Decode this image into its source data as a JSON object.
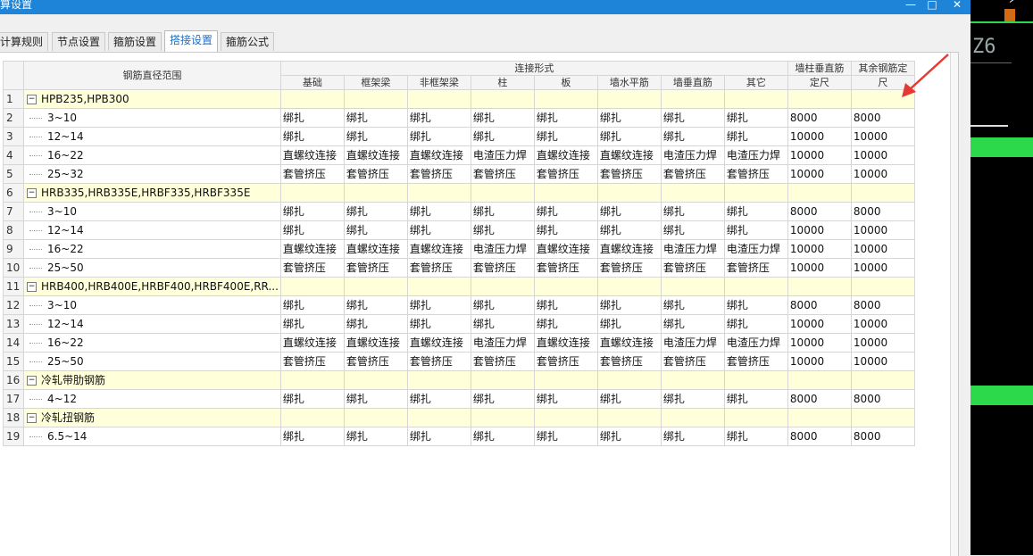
{
  "window": {
    "title": "计算设置",
    "title_visible": "算设置",
    "btn_min": "—",
    "btn_max": "□",
    "btn_close": "✕"
  },
  "tabs": [
    {
      "label": "计算规则",
      "visible": "计算规则"
    },
    {
      "label": "节点设置"
    },
    {
      "label": "箍筋设置"
    },
    {
      "label": "搭接设置",
      "active": true
    },
    {
      "label": "箍筋公式"
    }
  ],
  "table": {
    "header": {
      "range": "钢筋直径范围",
      "connection_group": "连接形式",
      "connection_cols": [
        "基础",
        "框架梁",
        "非框架梁",
        "柱",
        "板",
        "墙水平筋",
        "墙垂直筋",
        "其它"
      ],
      "col_wall_len_1": "墙柱垂直筋",
      "col_wall_len_2": "定尺",
      "col_other_len_1": "其余钢筋定",
      "col_other_len_2": "尺"
    },
    "rows": [
      {
        "n": "1",
        "group": true,
        "label": "HPB235,HPB300"
      },
      {
        "n": "2",
        "label": "3~10",
        "c": [
          "绑扎",
          "绑扎",
          "绑扎",
          "绑扎",
          "绑扎",
          "绑扎",
          "绑扎",
          "绑扎"
        ],
        "w": "8000",
        "o": "8000"
      },
      {
        "n": "3",
        "label": "12~14",
        "c": [
          "绑扎",
          "绑扎",
          "绑扎",
          "绑扎",
          "绑扎",
          "绑扎",
          "绑扎",
          "绑扎"
        ],
        "w": "10000",
        "o": "10000"
      },
      {
        "n": "4",
        "label": "16~22",
        "c": [
          "直螺纹连接",
          "直螺纹连接",
          "直螺纹连接",
          "电渣压力焊",
          "直螺纹连接",
          "直螺纹连接",
          "电渣压力焊",
          "电渣压力焊"
        ],
        "w": "10000",
        "o": "10000"
      },
      {
        "n": "5",
        "label": "25~32",
        "c": [
          "套管挤压",
          "套管挤压",
          "套管挤压",
          "套管挤压",
          "套管挤压",
          "套管挤压",
          "套管挤压",
          "套管挤压"
        ],
        "w": "10000",
        "o": "10000"
      },
      {
        "n": "6",
        "group": true,
        "label": "HRB335,HRB335E,HRBF335,HRBF335E"
      },
      {
        "n": "7",
        "label": "3~10",
        "c": [
          "绑扎",
          "绑扎",
          "绑扎",
          "绑扎",
          "绑扎",
          "绑扎",
          "绑扎",
          "绑扎"
        ],
        "w": "8000",
        "o": "8000"
      },
      {
        "n": "8",
        "label": "12~14",
        "c": [
          "绑扎",
          "绑扎",
          "绑扎",
          "绑扎",
          "绑扎",
          "绑扎",
          "绑扎",
          "绑扎"
        ],
        "w": "10000",
        "o": "10000"
      },
      {
        "n": "9",
        "label": "16~22",
        "c": [
          "直螺纹连接",
          "直螺纹连接",
          "直螺纹连接",
          "电渣压力焊",
          "直螺纹连接",
          "直螺纹连接",
          "电渣压力焊",
          "电渣压力焊"
        ],
        "w": "10000",
        "o": "10000"
      },
      {
        "n": "10",
        "label": "25~50",
        "c": [
          "套管挤压",
          "套管挤压",
          "套管挤压",
          "套管挤压",
          "套管挤压",
          "套管挤压",
          "套管挤压",
          "套管挤压"
        ],
        "w": "10000",
        "o": "10000"
      },
      {
        "n": "11",
        "group": true,
        "label": "HRB400,HRB400E,HRBF400,HRBF400E,RR..."
      },
      {
        "n": "12",
        "label": "3~10",
        "c": [
          "绑扎",
          "绑扎",
          "绑扎",
          "绑扎",
          "绑扎",
          "绑扎",
          "绑扎",
          "绑扎"
        ],
        "w": "8000",
        "o": "8000"
      },
      {
        "n": "13",
        "label": "12~14",
        "c": [
          "绑扎",
          "绑扎",
          "绑扎",
          "绑扎",
          "绑扎",
          "绑扎",
          "绑扎",
          "绑扎"
        ],
        "w": "10000",
        "o": "10000"
      },
      {
        "n": "14",
        "label": "16~22",
        "c": [
          "直螺纹连接",
          "直螺纹连接",
          "直螺纹连接",
          "电渣压力焊",
          "直螺纹连接",
          "直螺纹连接",
          "电渣压力焊",
          "电渣压力焊"
        ],
        "w": "10000",
        "o": "10000"
      },
      {
        "n": "15",
        "label": "25~50",
        "c": [
          "套管挤压",
          "套管挤压",
          "套管挤压",
          "套管挤压",
          "套管挤压",
          "套管挤压",
          "套管挤压",
          "套管挤压"
        ],
        "w": "10000",
        "o": "10000"
      },
      {
        "n": "16",
        "group": true,
        "label": "冷轧带肋钢筋"
      },
      {
        "n": "17",
        "label": "4~12",
        "c": [
          "绑扎",
          "绑扎",
          "绑扎",
          "绑扎",
          "绑扎",
          "绑扎",
          "绑扎",
          "绑扎"
        ],
        "w": "8000",
        "o": "8000"
      },
      {
        "n": "18",
        "group": true,
        "label": "冷轧扭钢筋"
      },
      {
        "n": "19",
        "label": "6.5~14",
        "c": [
          "绑扎",
          "绑扎",
          "绑扎",
          "绑扎",
          "绑扎",
          "绑扎",
          "绑扎",
          "绑扎"
        ],
        "w": "8000",
        "o": "8000"
      }
    ]
  },
  "side_panel": {
    "text": "Z6"
  },
  "colors": {
    "titlebar": "#1e84d8",
    "group_row": "#ffffd9",
    "arrow": "#e53935",
    "green": "#2bd94a",
    "active_tab_text": "#1e6fc8"
  },
  "icons": {
    "expand_toggle": "⊟"
  }
}
